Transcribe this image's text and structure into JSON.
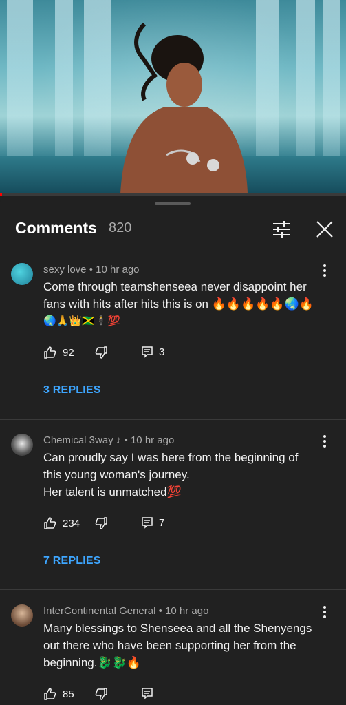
{
  "player": {
    "progress_fraction": 0.005
  },
  "header": {
    "title": "Comments",
    "count": "820"
  },
  "comments": [
    {
      "author": "sexy love",
      "time": "• 10 hr ago",
      "lines": [
        "Come through teamshenseea never disappoint her",
        "fans with hits after hits this is on 🔥🔥🔥🔥🔥🌏🔥",
        "🌏🙏👑🇯🇲🕴💯"
      ],
      "likes": "92",
      "reply_count": "3",
      "replies_label": "3 REPLIES"
    },
    {
      "author": "Chemical 3way ♪",
      "time": "• 10 hr ago",
      "lines": [
        "Can proudly say I was here from the beginning of",
        "this young woman's journey.",
        "Her talent is unmatched💯"
      ],
      "likes": "234",
      "reply_count": "7",
      "replies_label": "7 REPLIES"
    },
    {
      "author": "InterContinental General",
      "time": "• 10 hr ago",
      "lines": [
        "Many blessings to Shenseea and all the Shenyengs",
        "out there who have been supporting her from the",
        "beginning.🐉🐉🔥"
      ],
      "likes": "85",
      "reply_count": ""
    }
  ],
  "colors": {
    "accent_link": "#3ea6ff",
    "background": "#212121",
    "progress": "#ff0000"
  },
  "icons": [
    "filter-icon",
    "close-icon",
    "thumb-up-icon",
    "thumb-down-icon",
    "reply-icon",
    "more-vert-icon"
  ]
}
